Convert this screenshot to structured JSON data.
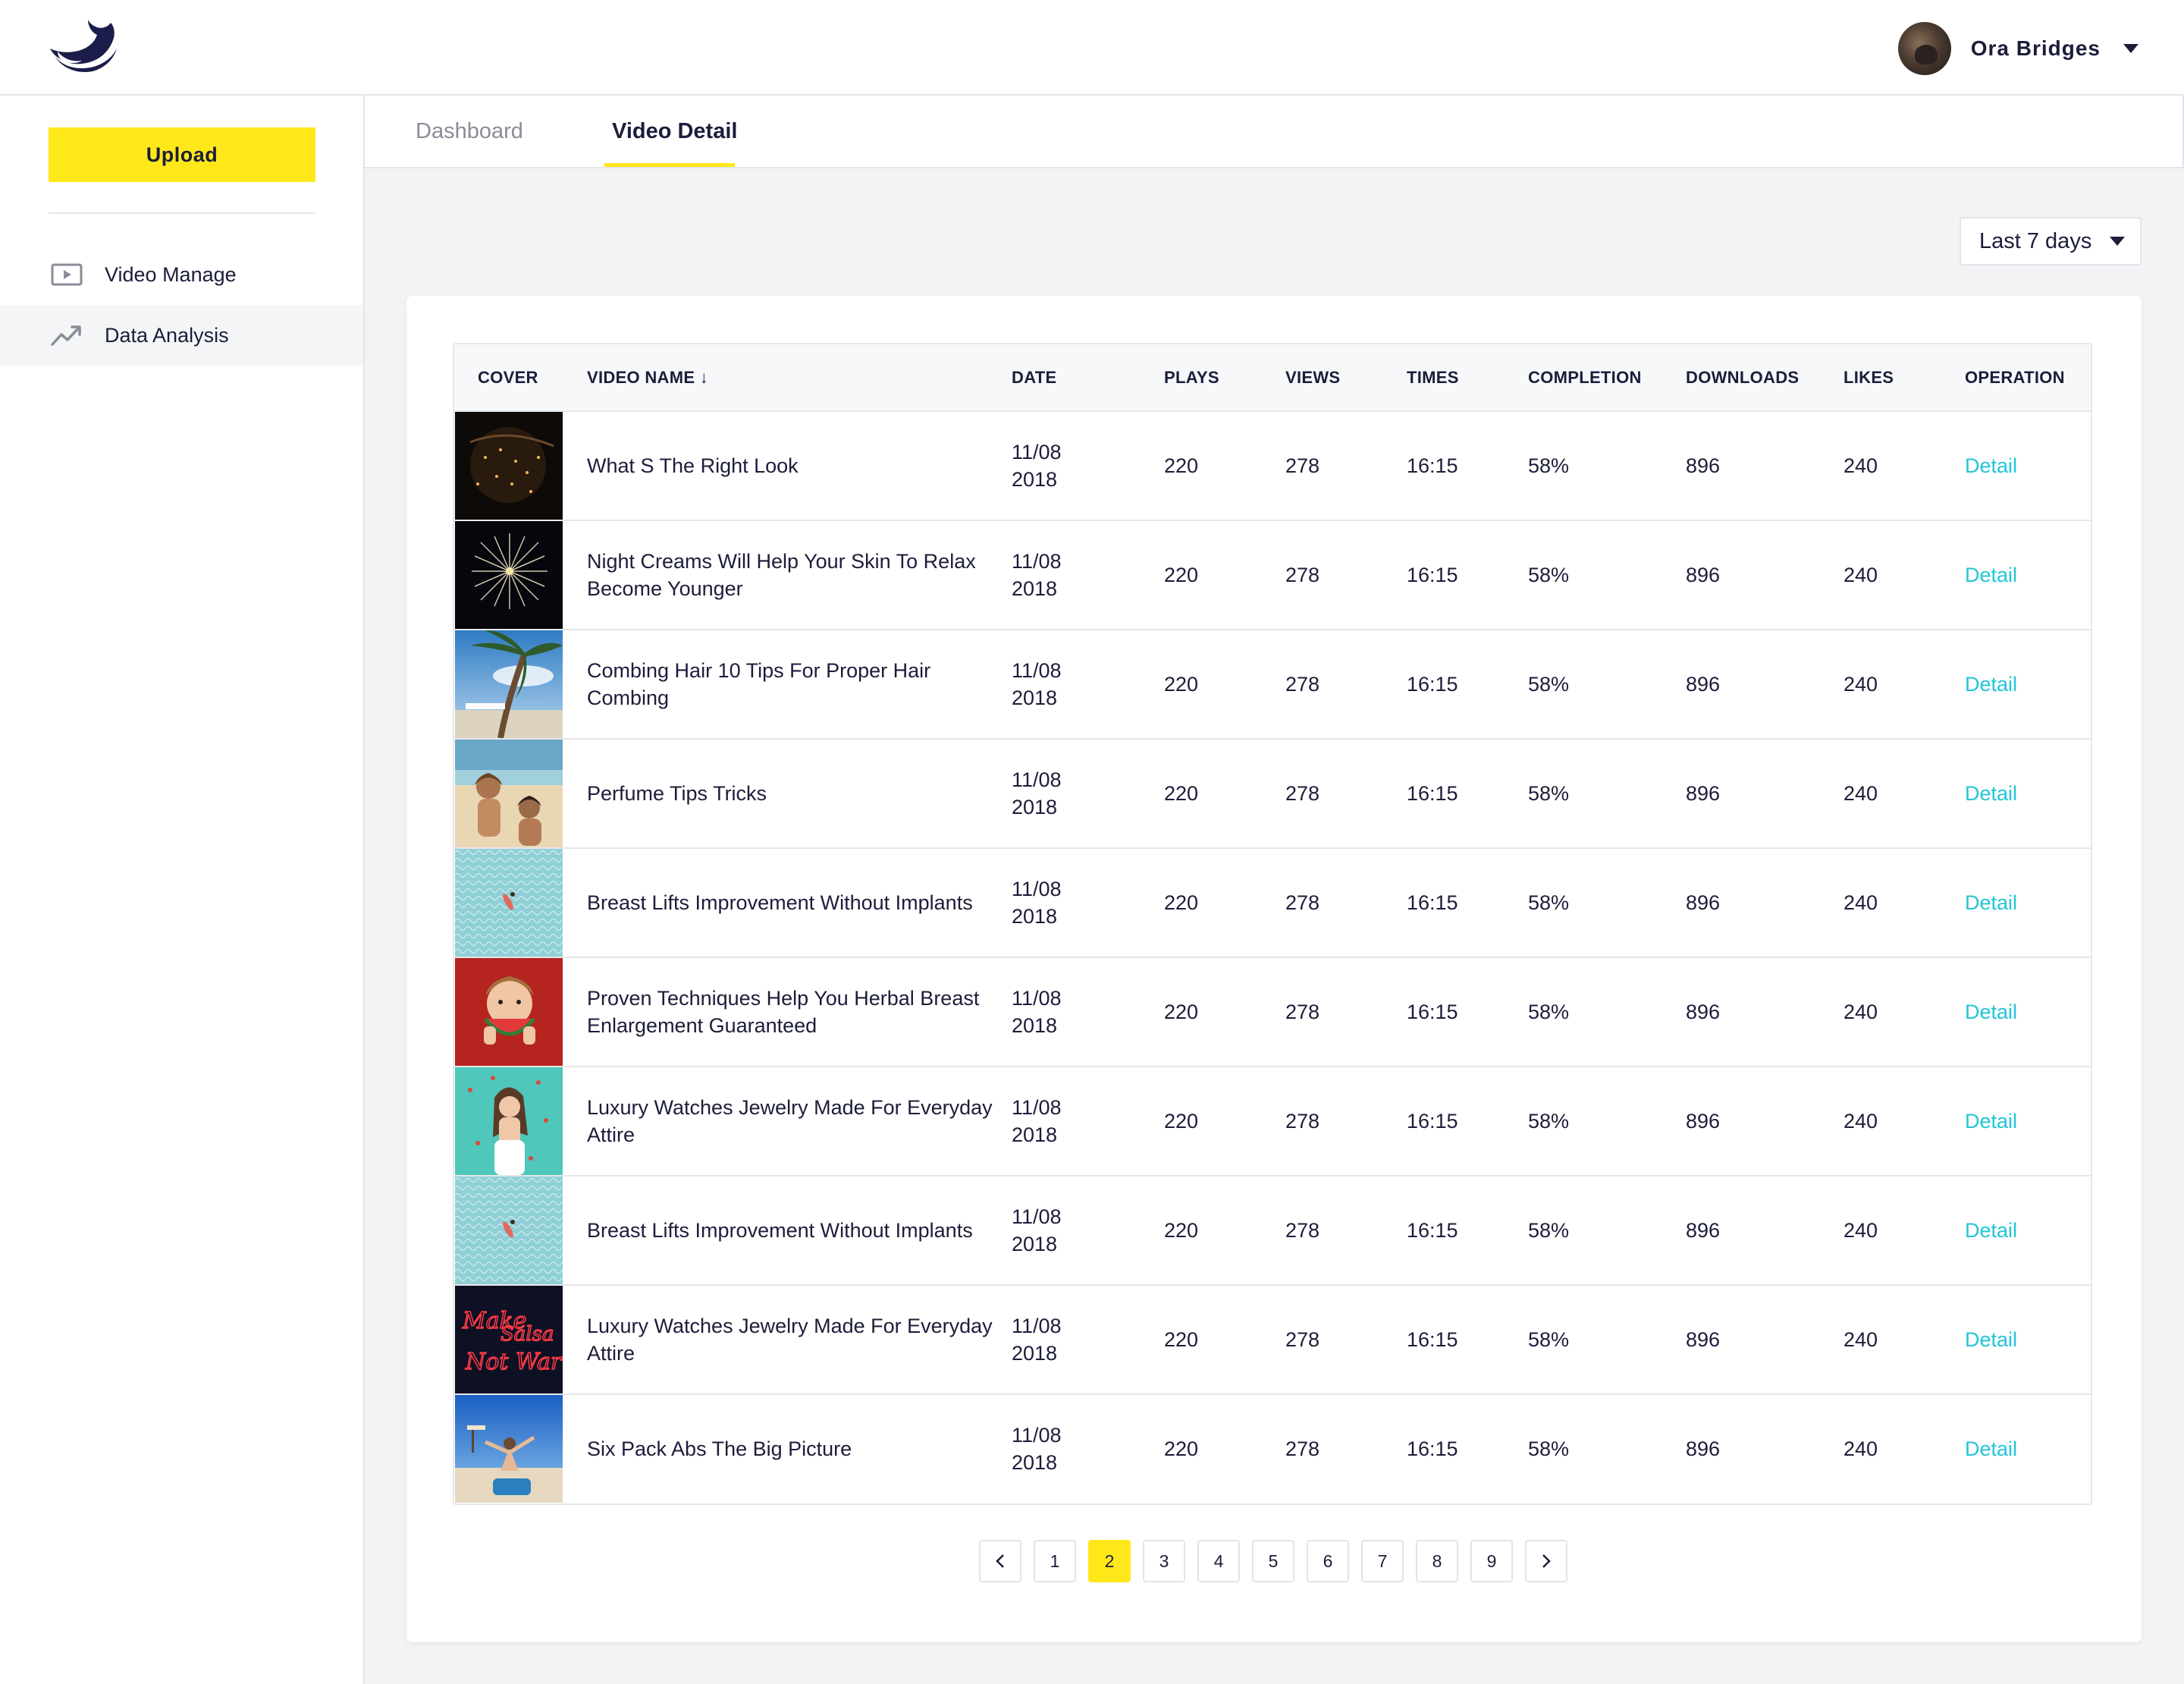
{
  "header": {
    "logo": "whale-logo",
    "user_name": "Ora Bridges"
  },
  "sidebar": {
    "upload_label": "Upload",
    "items": [
      {
        "label": "Video Manage",
        "icon": "video-icon",
        "active": false
      },
      {
        "label": "Data Analysis",
        "icon": "trend-chart-icon",
        "active": true
      }
    ]
  },
  "tabs": [
    {
      "label": "Dashboard",
      "active": false
    },
    {
      "label": "Video Detail",
      "active": true
    }
  ],
  "filter": {
    "selected": "Last 7 days"
  },
  "table": {
    "columns": [
      "COVER",
      "VIDEO NAME ↓",
      "DATE",
      "PLAYS",
      "VIEWS",
      "TIMES",
      "COMPLETION",
      "DOWNLOADS",
      "LIKES",
      "OPERATION"
    ],
    "rows": [
      {
        "cover": "night-city-aerial",
        "name": "What S The Right Look",
        "date_line1": "11/08",
        "date_line2": "2018",
        "plays": "220",
        "views": "278",
        "times": "16:15",
        "completion": "58%",
        "downloads": "896",
        "likes": "240",
        "operation": "Detail"
      },
      {
        "cover": "fireworks",
        "name": "Night Creams Will Help Your Skin To Relax Become Younger",
        "date_line1": "11/08",
        "date_line2": "2018",
        "plays": "220",
        "views": "278",
        "times": "16:15",
        "completion": "58%",
        "downloads": "896",
        "likes": "240",
        "operation": "Detail"
      },
      {
        "cover": "palm-beach",
        "name": "Combing Hair 10 Tips For Proper Hair Combing",
        "date_line1": "11/08",
        "date_line2": "2018",
        "plays": "220",
        "views": "278",
        "times": "16:15",
        "completion": "58%",
        "downloads": "896",
        "likes": "240",
        "operation": "Detail"
      },
      {
        "cover": "beach-friends",
        "name": "Perfume Tips Tricks",
        "date_line1": "11/08",
        "date_line2": "2018",
        "plays": "220",
        "views": "278",
        "times": "16:15",
        "completion": "58%",
        "downloads": "896",
        "likes": "240",
        "operation": "Detail"
      },
      {
        "cover": "swimmer-water",
        "name": "Breast Lifts Improvement Without Implants",
        "date_line1": "11/08",
        "date_line2": "2018",
        "plays": "220",
        "views": "278",
        "times": "16:15",
        "completion": "58%",
        "downloads": "896",
        "likes": "240",
        "operation": "Detail"
      },
      {
        "cover": "watermelon-girl",
        "name": "Proven Techniques Help You Herbal Breast Enlargement Guaranteed",
        "date_line1": "11/08",
        "date_line2": "2018",
        "plays": "220",
        "views": "278",
        "times": "16:15",
        "completion": "58%",
        "downloads": "896",
        "likes": "240",
        "operation": "Detail"
      },
      {
        "cover": "teal-portrait",
        "name": "Luxury Watches Jewelry Made For Everyday Attire",
        "date_line1": "11/08",
        "date_line2": "2018",
        "plays": "220",
        "views": "278",
        "times": "16:15",
        "completion": "58%",
        "downloads": "896",
        "likes": "240",
        "operation": "Detail"
      },
      {
        "cover": "swimmer-water",
        "name": "Breast Lifts Improvement Without Implants",
        "date_line1": "11/08",
        "date_line2": "2018",
        "plays": "220",
        "views": "278",
        "times": "16:15",
        "completion": "58%",
        "downloads": "896",
        "likes": "240",
        "operation": "Detail"
      },
      {
        "cover": "neon-sign",
        "name": "Luxury Watches Jewelry Made For Everyday Attire",
        "date_line1": "11/08",
        "date_line2": "2018",
        "plays": "220",
        "views": "278",
        "times": "16:15",
        "completion": "58%",
        "downloads": "896",
        "likes": "240",
        "operation": "Detail"
      },
      {
        "cover": "beach-sky",
        "name": "Six Pack Abs The Big Picture",
        "date_line1": "11/08",
        "date_line2": "2018",
        "plays": "220",
        "views": "278",
        "times": "16:15",
        "completion": "58%",
        "downloads": "896",
        "likes": "240",
        "operation": "Detail"
      }
    ]
  },
  "pagination": {
    "prev": "<",
    "next": ">",
    "pages": [
      "1",
      "2",
      "3",
      "4",
      "5",
      "6",
      "7",
      "8",
      "9"
    ],
    "current": "2"
  },
  "colors": {
    "accent": "#ffe81a",
    "link": "#21c6d6",
    "text": "#1c1d3a",
    "muted": "#8a8c99",
    "background": "#f2f3f5"
  }
}
